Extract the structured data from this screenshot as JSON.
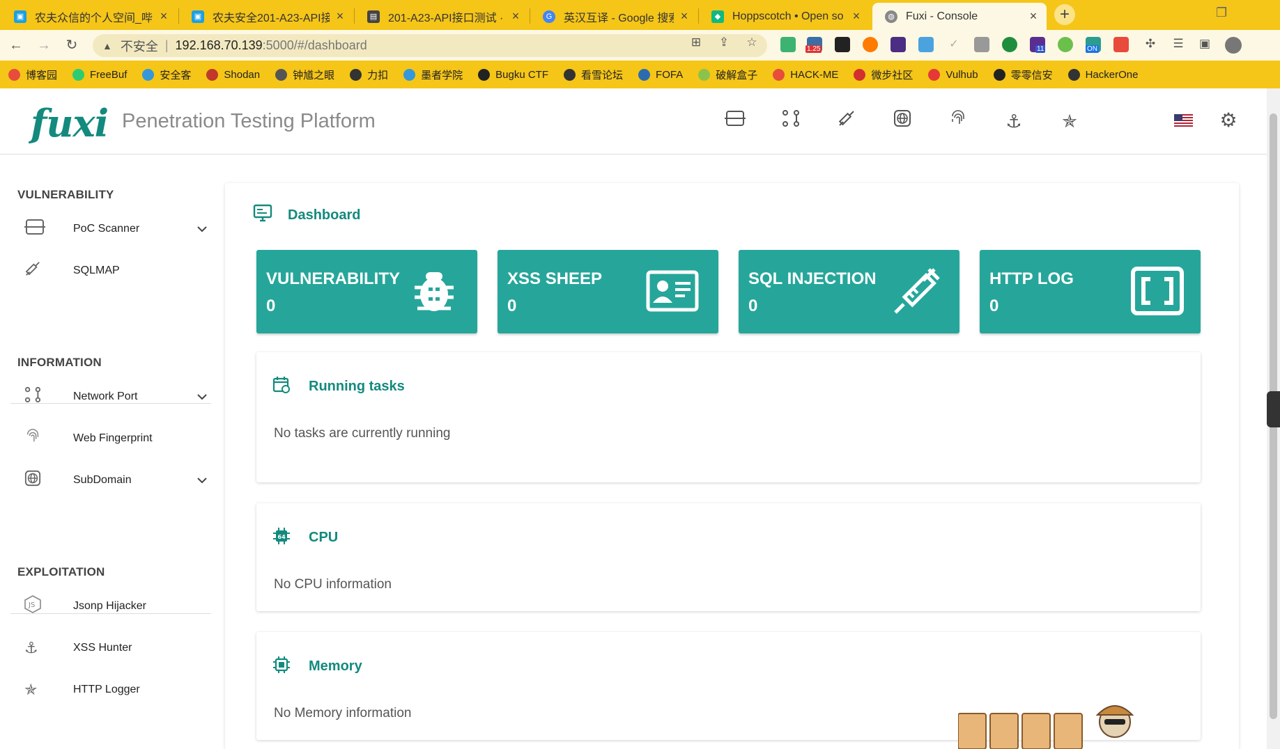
{
  "browser": {
    "tabs": [
      {
        "title": "农夫众信的个人空间_哔哩",
        "color": "#1ea0e0",
        "active": false
      },
      {
        "title": "农夫安全201-A23-API接",
        "color": "#1ea0e0",
        "active": false
      },
      {
        "title": "201-A23-API接口测试 · I",
        "color": "#444444",
        "active": false
      },
      {
        "title": "英汉互译 - Google 搜索",
        "color": "#4285f4",
        "active": false
      },
      {
        "title": "Hoppscotch • Open so",
        "color": "#10b981",
        "active": false
      },
      {
        "title": "Fuxi - Console",
        "color": "#777777",
        "active": true
      }
    ],
    "address": {
      "insecure_label": "不安全",
      "host": "192.168.70.139",
      "path": ":5000/#/dashboard"
    },
    "extension_badges": {
      "ext2": "1.25",
      "ext12": "11",
      "ext14": "ON"
    },
    "bookmarks": [
      {
        "label": "博客园",
        "color": "#e74c3c"
      },
      {
        "label": "FreeBuf",
        "color": "#2ecc71"
      },
      {
        "label": "安全客",
        "color": "#3498db"
      },
      {
        "label": "Shodan",
        "color": "#c0392b"
      },
      {
        "label": "钟馗之眼",
        "color": "#555555"
      },
      {
        "label": "力扣",
        "color": "#333333"
      },
      {
        "label": "墨者学院",
        "color": "#3498db"
      },
      {
        "label": "Bugku CTF",
        "color": "#222222"
      },
      {
        "label": "看雪论坛",
        "color": "#333333"
      },
      {
        "label": "FOFA",
        "color": "#2b6cb0"
      },
      {
        "label": "破解盒子",
        "color": "#8bc34a"
      },
      {
        "label": "HACK-ME",
        "color": "#e74c3c"
      },
      {
        "label": "微步社区",
        "color": "#d32f2f"
      },
      {
        "label": "Vulhub",
        "color": "#e53935"
      },
      {
        "label": "零零信安",
        "color": "#222222"
      },
      {
        "label": "HackerOne",
        "color": "#333333"
      }
    ]
  },
  "app": {
    "logo": "fuxi",
    "title": "Penetration Testing Platform",
    "accent": "#138a7d",
    "tile_color": "#26a69a",
    "topnav_icons": [
      "scanner-icon",
      "network-icon",
      "syringe-icon",
      "globe-icon",
      "fingerprint-icon",
      "anchor-icon",
      "spider-web-icon"
    ]
  },
  "sidebar": {
    "sections": [
      {
        "title": "VULNERABILITY",
        "items": [
          {
            "label": "PoC Scanner",
            "icon": "scanner-icon",
            "expandable": true
          },
          {
            "label": "SQLMAP",
            "icon": "syringe-icon",
            "expandable": false
          }
        ]
      },
      {
        "title": "INFORMATION",
        "items": [
          {
            "label": "Network Port",
            "icon": "network-icon",
            "expandable": true
          },
          {
            "label": "Web Fingerprint",
            "icon": "fingerprint-icon",
            "expandable": false
          },
          {
            "label": "SubDomain",
            "icon": "globe-icon",
            "expandable": true
          }
        ]
      },
      {
        "title": "EXPLOITATION",
        "items": [
          {
            "label": "Jsonp Hijacker",
            "icon": "js-icon",
            "expandable": false
          },
          {
            "label": "XSS Hunter",
            "icon": "anchor-icon",
            "expandable": false
          },
          {
            "label": "HTTP Logger",
            "icon": "spider-web-icon",
            "expandable": false
          }
        ]
      }
    ]
  },
  "dashboard": {
    "title": "Dashboard",
    "stats": [
      {
        "title": "VULNERABILITY",
        "value": "0",
        "icon": "bug-icon"
      },
      {
        "title": "XSS SHEEP",
        "value": "0",
        "icon": "id-card-icon"
      },
      {
        "title": "SQL INJECTION",
        "value": "0",
        "icon": "syringe-icon"
      },
      {
        "title": "HTTP LOG",
        "value": "0",
        "icon": "brackets-icon"
      }
    ],
    "cards": [
      {
        "title": "Running tasks",
        "body": "No tasks are currently running",
        "icon": "calendar-sync-icon"
      },
      {
        "title": "CPU",
        "body": "No CPU information",
        "icon": "chip-64-icon"
      },
      {
        "title": "Memory",
        "body": "No Memory information",
        "icon": "memory-chip-icon"
      }
    ]
  }
}
